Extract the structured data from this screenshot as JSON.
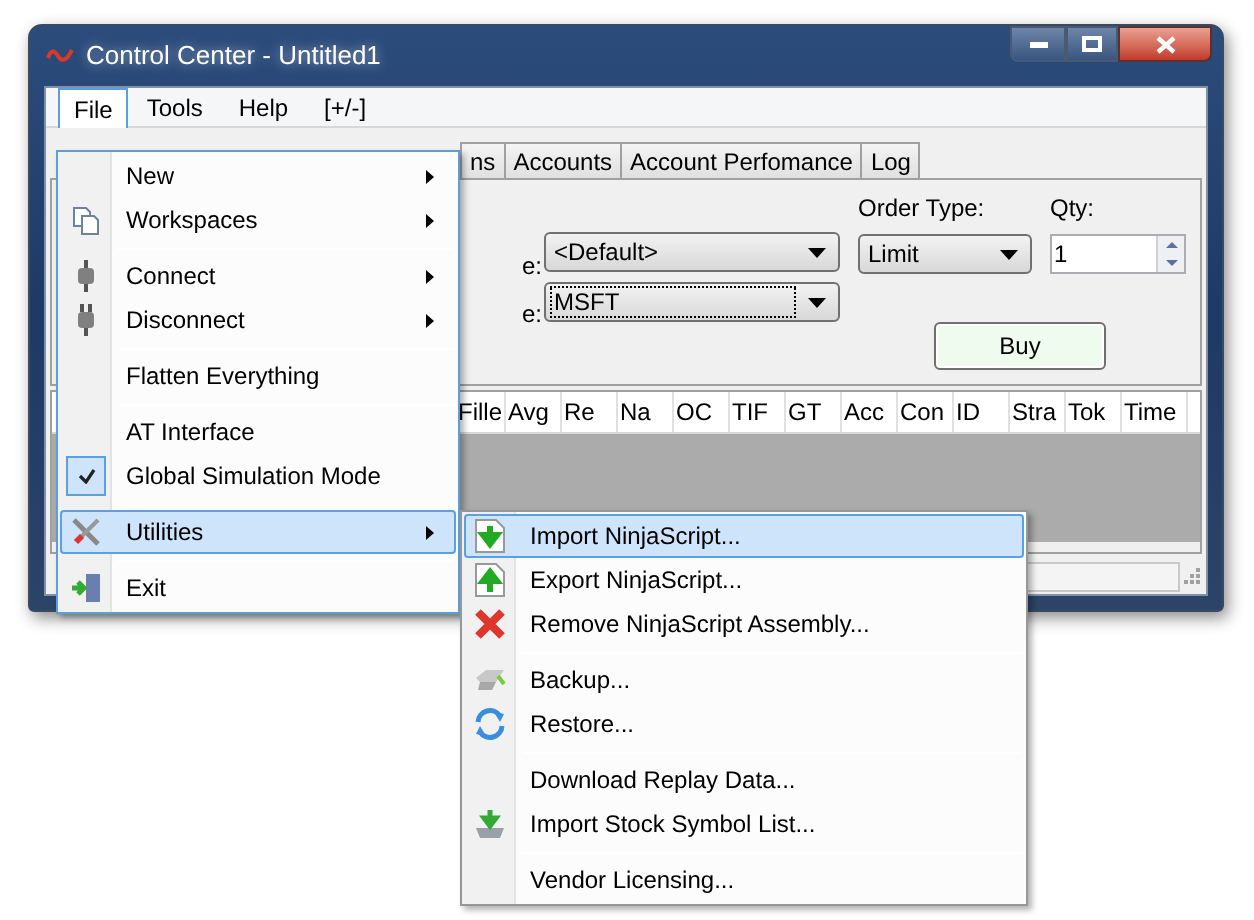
{
  "window": {
    "title": "Control Center - Untitled1"
  },
  "menu_bar": [
    {
      "label": "File",
      "selected": true
    },
    {
      "label": "Tools",
      "selected": false
    },
    {
      "label": "Help",
      "selected": false
    },
    {
      "label": "[+/-]",
      "selected": false
    }
  ],
  "tabs": [
    {
      "label": "ns",
      "selected": false
    },
    {
      "label": "Accounts",
      "selected": false
    },
    {
      "label": "Account Perfomance",
      "selected": false
    },
    {
      "label": "Log",
      "selected": false
    }
  ],
  "order_panel": {
    "row_labels": [
      "e:",
      "e:"
    ],
    "account_dropdown": {
      "value": "<Default>",
      "focused": false
    },
    "instrument_dropdown": {
      "value": "MSFT",
      "focused": true
    },
    "order_type_label": "Order Type:",
    "order_type_dropdown": {
      "value": "Limit",
      "focused": false
    },
    "qty_label": "Qty:",
    "qty_field": {
      "value": "1"
    },
    "buy_button": "Buy"
  },
  "orders_table": {
    "columns": [
      "Fille",
      "Avg",
      "Re",
      "Na",
      "OC",
      "TIF",
      "GT",
      "Acc",
      "Con",
      "ID",
      "Stra",
      "Tok",
      "Time"
    ]
  },
  "file_menu": {
    "groups": [
      [
        {
          "label": "New",
          "submenu": true,
          "checked": false,
          "selected": false
        },
        {
          "label": "Workspaces",
          "submenu": true,
          "checked": false,
          "selected": false
        }
      ],
      [
        {
          "label": "Connect",
          "submenu": true,
          "checked": false,
          "selected": false
        },
        {
          "label": "Disconnect",
          "submenu": true,
          "checked": false,
          "selected": false
        }
      ],
      [
        {
          "label": "Flatten Everything",
          "submenu": false,
          "checked": false,
          "selected": false
        }
      ],
      [
        {
          "label": "AT Interface",
          "submenu": false,
          "checked": false,
          "selected": false
        },
        {
          "label": "Global Simulation Mode",
          "submenu": false,
          "checked": true,
          "selected": false
        }
      ],
      [
        {
          "label": "Utilities",
          "submenu": true,
          "checked": false,
          "selected": true
        }
      ],
      [
        {
          "label": "Exit",
          "submenu": false,
          "checked": false,
          "selected": false
        }
      ]
    ]
  },
  "utilities_submenu": {
    "groups": [
      [
        {
          "label": "Import NinjaScript...",
          "selected": true
        },
        {
          "label": "Export NinjaScript...",
          "selected": false
        },
        {
          "label": "Remove NinjaScript Assembly...",
          "selected": false
        }
      ],
      [
        {
          "label": "Backup...",
          "selected": false
        },
        {
          "label": "Restore...",
          "selected": false
        }
      ],
      [
        {
          "label": "Download Replay Data...",
          "selected": false
        },
        {
          "label": "Import Stock Symbol List...",
          "selected": false
        }
      ],
      [
        {
          "label": "Vendor Licensing...",
          "selected": false
        }
      ]
    ]
  }
}
